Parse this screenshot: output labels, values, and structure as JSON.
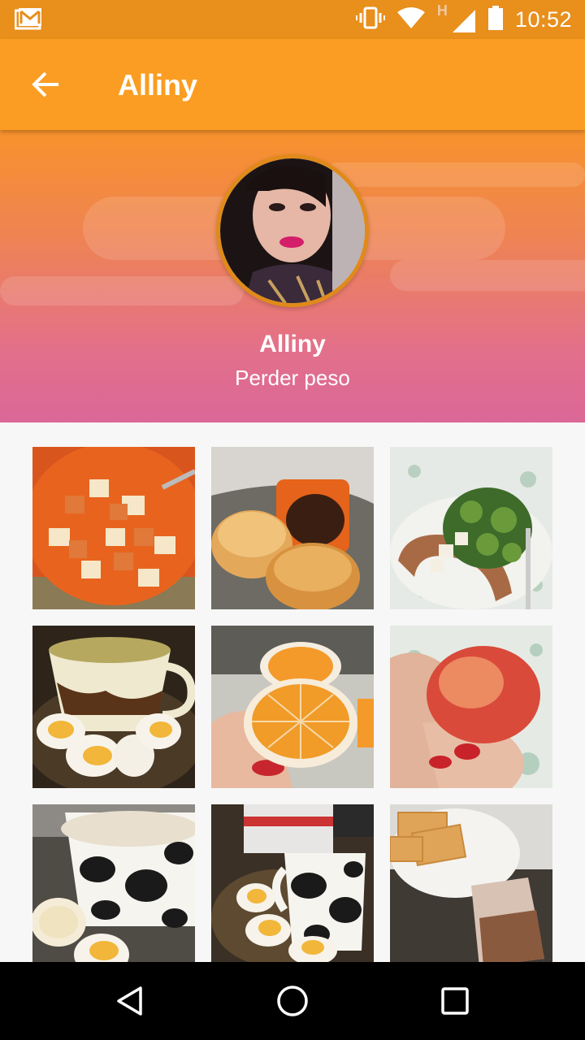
{
  "status_bar": {
    "time": "10:52",
    "network_label": "H",
    "icons": [
      "gmail-icon",
      "vibrate-icon",
      "wifi-icon",
      "signal-icon",
      "battery-icon"
    ]
  },
  "app_bar": {
    "title": "Alliny",
    "back_icon": "arrow-back-icon"
  },
  "profile": {
    "name": "Alliny",
    "goal": "Perder peso"
  },
  "colors": {
    "status_bar": "#e88f1c",
    "app_bar": "#fb9d22",
    "header_top": "#f8922c",
    "header_bottom": "#da6797",
    "avatar_ring": "#e08a1a"
  },
  "photos": [
    "fruit-salad-photo",
    "bread-and-coffee-photo",
    "sausage-broccoli-photo",
    "tea-and-eggs-photo",
    "orange-halves-photo",
    "apple-in-hand-photo",
    "milk-and-banana-photo",
    "eggs-and-cow-mug-photo",
    "crackers-and-chocolate-milk-photo"
  ],
  "nav_bar": {
    "icons": [
      "back-triangle-icon",
      "home-circle-icon",
      "recents-square-icon"
    ]
  }
}
